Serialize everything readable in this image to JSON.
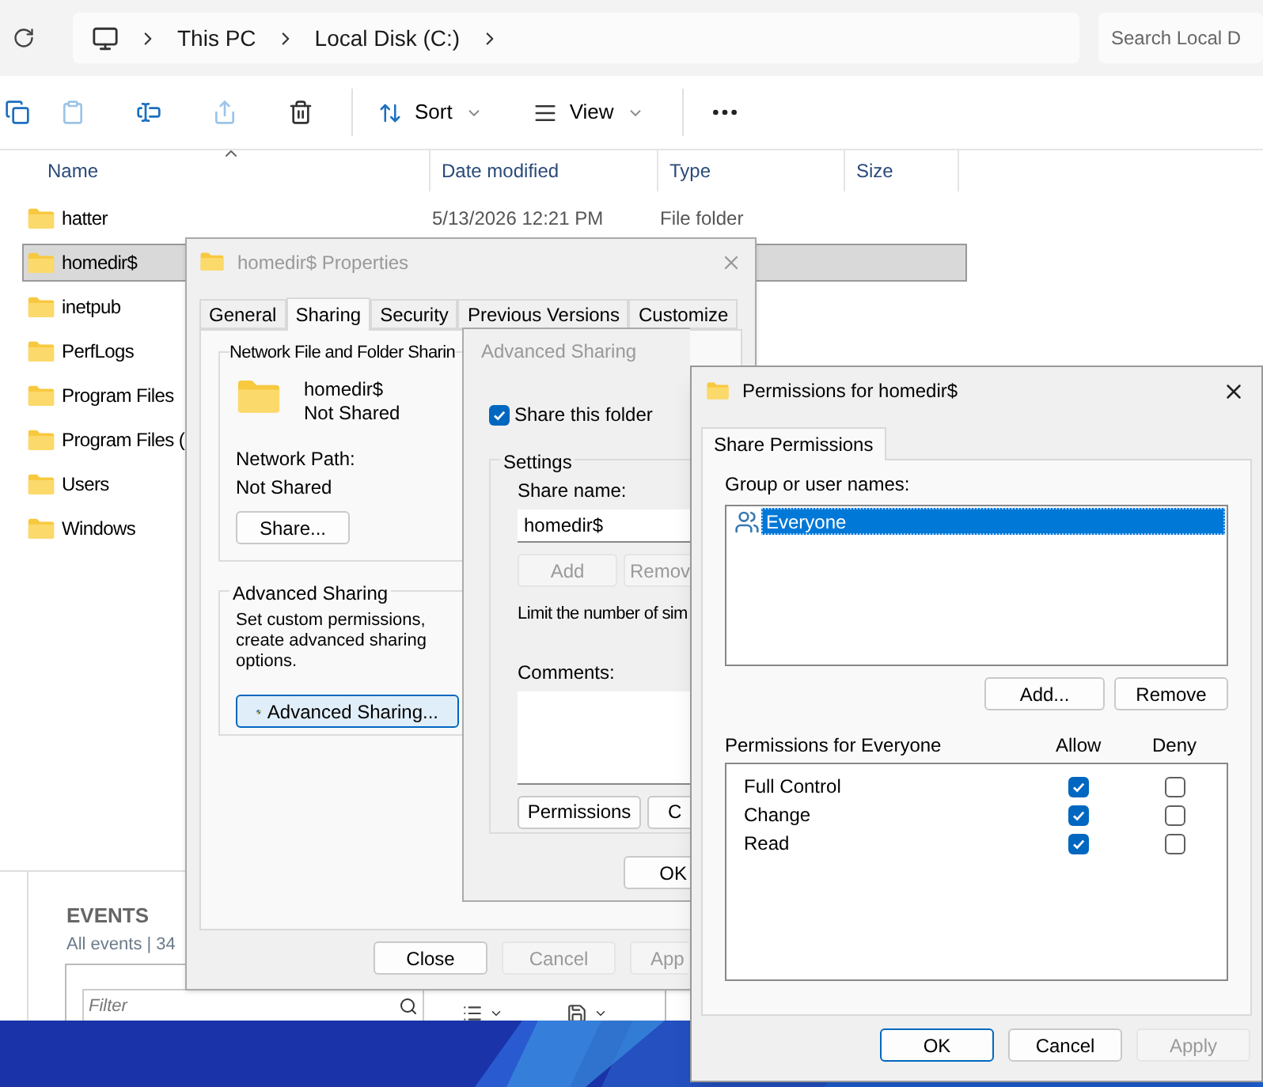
{
  "explorer": {
    "breadcrumb": [
      "This PC",
      "Local Disk (C:)"
    ],
    "search": {
      "placeholder": "Search Local D"
    },
    "tools": [
      {
        "kind": "copy",
        "disabled": false
      },
      {
        "kind": "paste",
        "disabled": true
      },
      {
        "kind": "rename",
        "disabled": false
      },
      {
        "kind": "share",
        "disabled": true
      },
      {
        "kind": "delete",
        "disabled": false
      }
    ],
    "sort": "Sort",
    "view": "View",
    "columns": [
      "Name",
      "Date modified",
      "Type",
      "Size"
    ],
    "rows": [
      {
        "name": "hatter",
        "date": "5/13/2026 12:21 PM",
        "type": "File folder",
        "selected": false
      },
      {
        "name": "homedir$",
        "selected": true
      },
      {
        "name": "inetpub",
        "selected": false
      },
      {
        "name": "PerfLogs",
        "selected": false
      },
      {
        "name": "Program Files",
        "selected": false
      },
      {
        "name": "Program Files (",
        "selected": false
      },
      {
        "name": "Users",
        "selected": false
      },
      {
        "name": "Windows",
        "selected": false
      }
    ]
  },
  "events": {
    "title": "EVENTS",
    "subtitle": "All events | 34",
    "filter": {
      "placeholder": "Filter"
    }
  },
  "properties": {
    "title": "homedir$ Properties",
    "tabs": [
      {
        "label": "General",
        "selected": false
      },
      {
        "label": "Sharing",
        "selected": true
      },
      {
        "label": "Security",
        "selected": false
      },
      {
        "label": "Previous Versions",
        "selected": false
      },
      {
        "label": "Customize",
        "selected": false
      }
    ],
    "network_group": "Network File and Folder Sharin",
    "folder_name": "homedir$",
    "status": "Not Shared",
    "network_path_label": "Network Path:",
    "network_path": "Not Shared",
    "share_button": "Share...",
    "advanced_group": "Advanced Sharing",
    "description": "Set custom permissions, create advanced sharing options.",
    "advanced_button": "Advanced Sharing...",
    "buttons": [
      {
        "label": "Close",
        "disabled": false
      },
      {
        "label": "Cancel",
        "disabled": true
      },
      {
        "label": "App",
        "disabled": true
      }
    ]
  },
  "advanced": {
    "title": "Advanced Sharing",
    "share_folder": {
      "label": "Share this folder",
      "checked": true
    },
    "settings": "Settings",
    "share_name_label": "Share name:",
    "share_name": "homedir$",
    "add": {
      "label": "Add",
      "disabled": true
    },
    "remove": {
      "label": "Remov",
      "disabled": true
    },
    "limit": "Limit the number of sim",
    "comments_label": "Comments:",
    "permissions_button": "Permissions",
    "caching_button": "C",
    "ok": "OK"
  },
  "permissions": {
    "title": "Permissions for homedir$",
    "tab": "Share Permissions",
    "group_label": "Group or user names:",
    "users": [
      {
        "name": "Everyone",
        "selected": true
      }
    ],
    "add": "Add...",
    "remove": "Remove",
    "perms_label": "Permissions for Everyone",
    "allow_label": "Allow",
    "deny_label": "Deny",
    "perms": [
      {
        "name": "Full Control",
        "allow": true,
        "deny": false
      },
      {
        "name": "Change",
        "allow": true,
        "deny": false
      },
      {
        "name": "Read",
        "allow": true,
        "deny": false
      }
    ],
    "buttons": [
      {
        "label": "OK",
        "disabled": false,
        "default": true
      },
      {
        "label": "Cancel",
        "disabled": false,
        "default": false
      },
      {
        "label": "Apply",
        "disabled": true,
        "default": false
      }
    ]
  }
}
